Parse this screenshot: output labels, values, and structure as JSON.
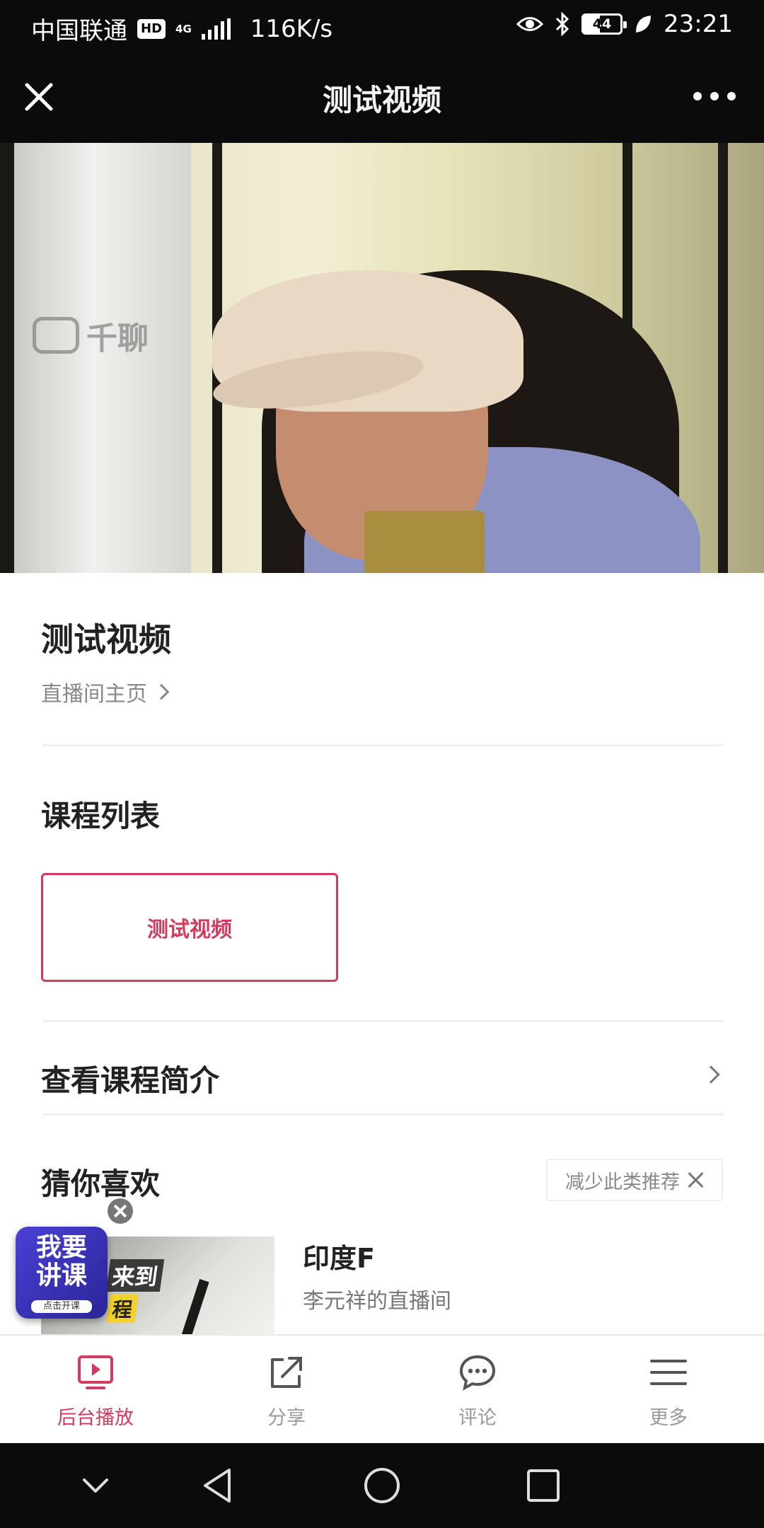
{
  "status_bar": {
    "carrier": "中国联通",
    "hd_badge": "HD",
    "network": "4G",
    "speed": "116K/s",
    "battery": "44",
    "time": "23:21",
    "icons": [
      "eye-icon",
      "bluetooth-icon",
      "battery-icon",
      "leaf-icon"
    ]
  },
  "header": {
    "title": "测试视频",
    "close_icon": "close-icon",
    "more_icon": "more-icon"
  },
  "video": {
    "watermark": "千聊"
  },
  "course": {
    "title": "测试视频",
    "home_link": "直播间主页"
  },
  "lessons": {
    "heading": "课程列表",
    "items": [
      {
        "label": "测试视频",
        "selected": true
      }
    ],
    "accent_color": "#d23b5e"
  },
  "intro": {
    "label": "查看课程简介"
  },
  "recommend": {
    "heading": "猜你喜欢",
    "reduce_label": "减少此类推荐",
    "items": [
      {
        "title": "印度F",
        "subtitle": "李元祥的直播间",
        "thumb_text_1": "来到",
        "thumb_text_2": "程"
      }
    ]
  },
  "floating_badge": {
    "line1": "我要",
    "line2": "讲课",
    "small": "点击开课"
  },
  "tabs": [
    {
      "label": "后台播放",
      "icon": "play-screen-icon",
      "active": true
    },
    {
      "label": "分享",
      "icon": "share-icon",
      "active": false
    },
    {
      "label": "评论",
      "icon": "comment-icon",
      "active": false
    },
    {
      "label": "更多",
      "icon": "menu-icon",
      "active": false
    }
  ],
  "nav": [
    "chevron-down-icon",
    "back-icon",
    "home-icon",
    "recents-icon"
  ]
}
